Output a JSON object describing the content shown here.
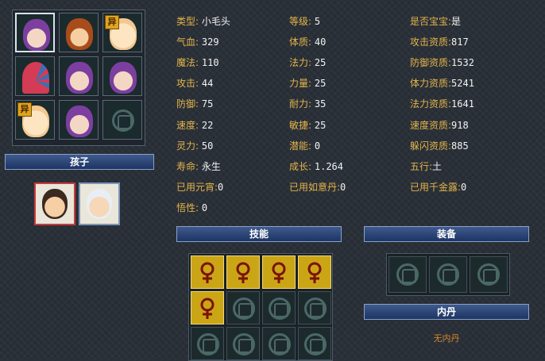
{
  "portraits": [
    {
      "type": "hair-purple",
      "selected": true,
      "badge": ""
    },
    {
      "type": "hair-fire",
      "selected": false,
      "badge": ""
    },
    {
      "type": "bald",
      "selected": false,
      "badge": "异"
    },
    {
      "type": "umbrella",
      "selected": false,
      "badge": ""
    },
    {
      "type": "hair-purple",
      "selected": false,
      "badge": ""
    },
    {
      "type": "hair-purple",
      "selected": false,
      "badge": ""
    },
    {
      "type": "bald",
      "selected": false,
      "badge": "异"
    },
    {
      "type": "hair-purple",
      "selected": false,
      "badge": ""
    },
    {
      "type": "empty",
      "selected": false,
      "badge": ""
    }
  ],
  "left": {
    "children_title": "孩子"
  },
  "stats": {
    "type_label": "类型:",
    "type_value": "小毛头",
    "level_label": "等级:",
    "level_value": "5",
    "is_baby_label": "是否宝宝:",
    "is_baby_value": "是",
    "hp_label": "气血:",
    "hp_value": "329",
    "con_label": "体质:",
    "con_value": "40",
    "atk_apt_label": "攻击资质:",
    "atk_apt_value": "817",
    "mp_label": "魔法:",
    "mp_value": "110",
    "magic_label": "法力:",
    "magic_value": "25",
    "def_apt_label": "防御资质:",
    "def_apt_value": "1532",
    "atk_label": "攻击:",
    "atk_value": "44",
    "str_label": "力量:",
    "str_value": "25",
    "sta_apt_label": "体力资质:",
    "sta_apt_value": "5241",
    "def_label": "防御:",
    "def_value": "75",
    "end_label": "耐力:",
    "end_value": "35",
    "mag_apt_label": "法力资质:",
    "mag_apt_value": "1641",
    "spd_label": "速度:",
    "spd_value": "22",
    "agi_label": "敏捷:",
    "agi_value": "25",
    "spd_apt_label": "速度资质:",
    "spd_apt_value": "918",
    "spi_label": "灵力:",
    "spi_value": "50",
    "pot_label": "潜能:",
    "pot_value": "0",
    "dodge_apt_label": "躲闪资质:",
    "dodge_apt_value": "885",
    "life_label": "寿命:",
    "life_value": "永生",
    "growth_label": "成长:",
    "growth_value": "1.264",
    "element_label": "五行:",
    "element_value": "土",
    "yuanxiao_label": "已用元宵:",
    "yuanxiao_value": "0",
    "ruyi_label": "已用如意丹:",
    "ruyi_value": "0",
    "qianjin_label": "已用千金露:",
    "qianjin_value": "0",
    "wux_label": "悟性:",
    "wux_value": "0"
  },
  "skills": {
    "title": "技能",
    "icons": [
      "skill-heart-question-icon",
      "skill-skeleton-icon",
      "skill-crab-icon",
      "skill-cat-icon",
      "skill-totem-icon"
    ]
  },
  "equipment": {
    "title": "装备"
  },
  "neidan": {
    "title": "内丹",
    "empty_text": "无内丹"
  }
}
